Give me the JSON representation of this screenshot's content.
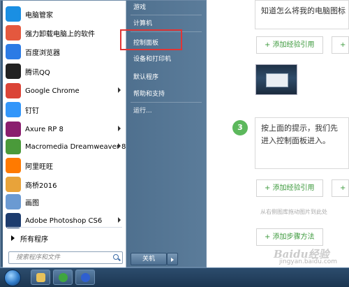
{
  "page": {
    "question_text": "知道怎么将我的电脑图标",
    "add_experience_label": "+ 添加经验引用",
    "add_second_label": "+ 添",
    "step_number": "3",
    "step_text": "按上面的提示，我们先进入控制面板进入。",
    "hint_text": "从右侧图库拖动图片到此处",
    "add_step_label": "+ 添加步骤方法",
    "watermark": "Baidu经验",
    "watermark_url": "jingyan.baidu.com"
  },
  "start_menu": {
    "programs": [
      {
        "label": "电脑管家",
        "icon": "shield-icon",
        "color": "#1a8fe3",
        "arrow": false
      },
      {
        "label": "强力卸载电脑上的软件",
        "icon": "uninstall-icon",
        "color": "#e4583e",
        "arrow": false
      },
      {
        "label": "百度浏览器",
        "icon": "baidu-browser-icon",
        "color": "#2c7be5",
        "arrow": false
      },
      {
        "label": "腾讯QQ",
        "icon": "qq-icon",
        "color": "#222222",
        "arrow": false
      },
      {
        "label": "Google Chrome",
        "icon": "chrome-icon",
        "color": "#db4437",
        "arrow": true
      },
      {
        "label": "钉钉",
        "icon": "dingtalk-icon",
        "color": "#3296fa",
        "arrow": false
      },
      {
        "label": "Axure RP 8",
        "icon": "axure-icon",
        "color": "#8a1f6e",
        "arrow": true
      },
      {
        "label": "Macromedia Dreamweaver 8",
        "icon": "dreamweaver-icon",
        "color": "#4a9a3a",
        "arrow": true
      },
      {
        "label": "阿里旺旺",
        "icon": "wangwang-icon",
        "color": "#ff7a00",
        "arrow": false
      },
      {
        "label": "商桥2016",
        "icon": "shangqiao-icon",
        "color": "#e8a33a",
        "arrow": false
      },
      {
        "label": "画图",
        "icon": "paint-icon",
        "color": "#6b9ad2",
        "arrow": false
      },
      {
        "label": "Adobe Photoshop CS6",
        "icon": "photoshop-icon",
        "color": "#1d3c6e",
        "arrow": true
      }
    ],
    "all_programs": "所有程序",
    "search_placeholder": "搜索程序和文件",
    "right_items": [
      "游戏",
      "计算机",
      "控制面板",
      "设备和打印机",
      "默认程序",
      "帮助和支持",
      "运行..."
    ],
    "shutdown_label": "关机"
  }
}
